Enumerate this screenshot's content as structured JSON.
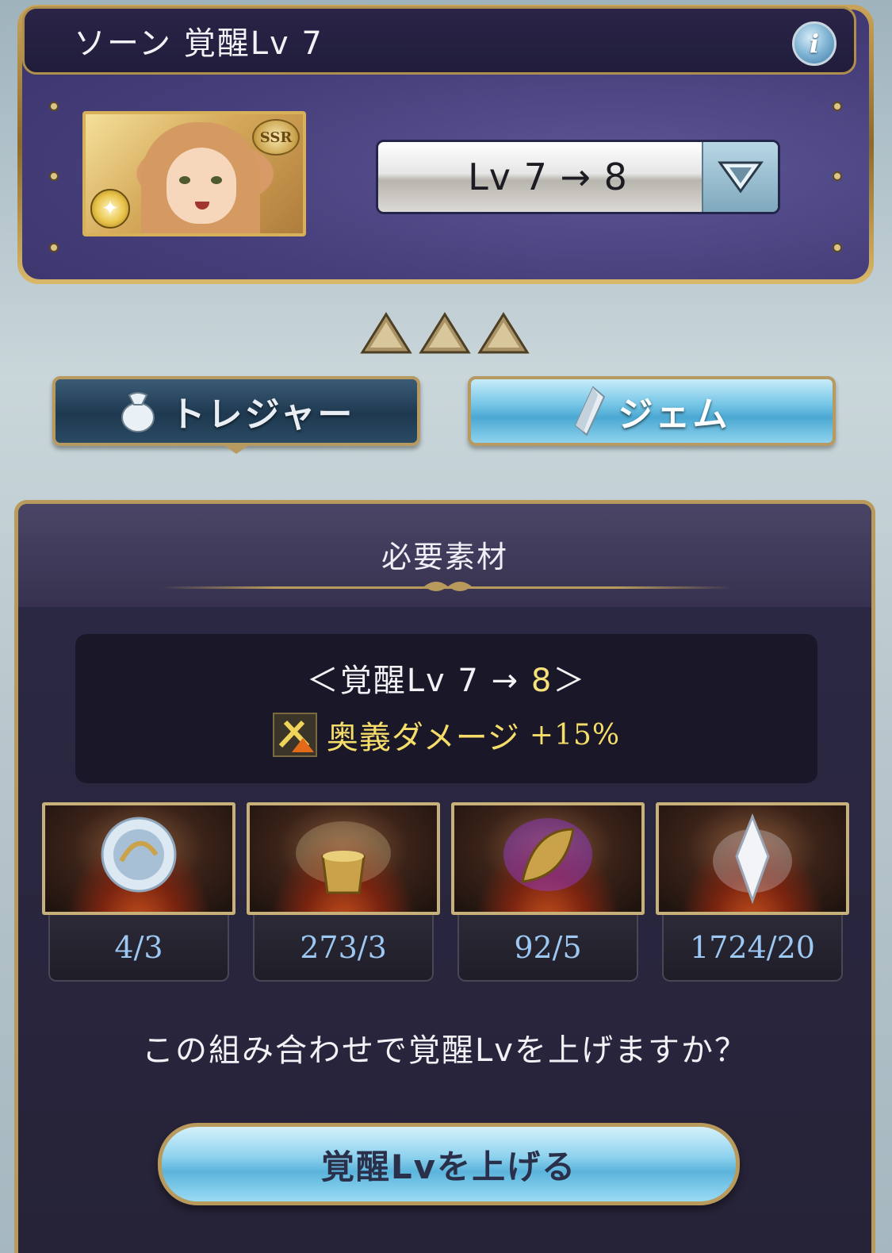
{
  "header": {
    "title": "ソーン  覚醒Lv 7",
    "info_icon": "i"
  },
  "character": {
    "rarity": "SSR",
    "element_icon": "light-element-icon"
  },
  "level_select": {
    "value": "Lv 7 → 8"
  },
  "stars": {
    "count": 3
  },
  "tabs": {
    "treasure_label": "トレジャー",
    "gem_label": "ジェム",
    "active": "treasure"
  },
  "materials_panel": {
    "title": "必要素材",
    "bonus_title_prefix": "＜覚醒Lv 7 → ",
    "bonus_title_target": "8",
    "bonus_title_suffix": "＞",
    "bonus_effect_label": "奥義ダメージ",
    "bonus_effect_value": "+15%",
    "items": [
      {
        "name": "sphere-material",
        "count": "4/3"
      },
      {
        "name": "chalice-material",
        "count": "273/3"
      },
      {
        "name": "leaf-material",
        "count": "92/5"
      },
      {
        "name": "crystal-material",
        "count": "1724/20"
      }
    ],
    "confirm_text": "この組み合わせで覚醒Lvを上げますか？",
    "awaken_button_label": "覚醒Lvを上げる"
  },
  "colors": {
    "accent_gold": "#b89a5c",
    "count_blue": "#9cc8f3",
    "highlight_yellow": "#f7e27a"
  }
}
